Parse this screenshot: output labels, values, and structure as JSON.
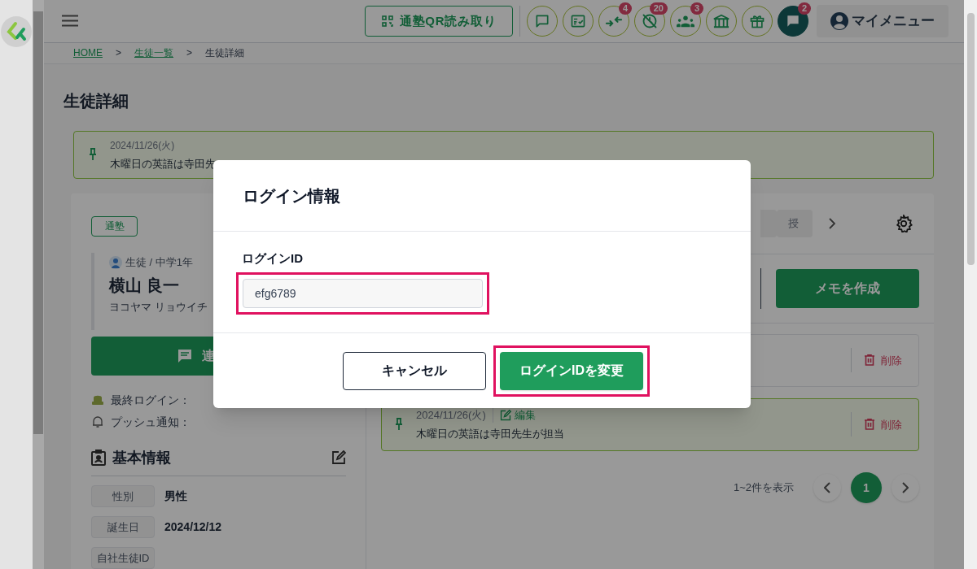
{
  "header": {
    "qr_button": "通塾QR読み取り",
    "icons": [
      {
        "kind": "chat",
        "filled": false
      },
      {
        "kind": "checklist",
        "filled": false
      },
      {
        "kind": "arrows",
        "filled": false,
        "badge": "4"
      },
      {
        "kind": "clock-off",
        "filled": false,
        "badge": "20"
      },
      {
        "kind": "group",
        "filled": false,
        "badge": "3"
      },
      {
        "kind": "bank",
        "filled": false
      },
      {
        "kind": "gift",
        "filled": false
      },
      {
        "kind": "chat",
        "filled": true,
        "badge": "2"
      }
    ],
    "my_menu": "マイメニュー"
  },
  "breadcrumb": {
    "items": [
      {
        "label": "HOME",
        "link": true
      },
      {
        "label": "生徒一覧",
        "link": true
      },
      {
        "label": "生徒詳細",
        "link": false
      }
    ],
    "separators": [
      ">",
      ">"
    ]
  },
  "page_title": "生徒詳細",
  "pinned_note": {
    "date": "2024/11/26(火)",
    "text": "木曜日の英語は寺田先"
  },
  "student": {
    "status_tag": "通塾",
    "role": "生徒 / 中学1年",
    "name": "横山 良一",
    "kana": "ヨコヤマ リョウイチ",
    "contact_button": "連",
    "last_login_label": "最終ログイン：",
    "push_label": "プッシュ通知："
  },
  "basic_info": {
    "title": "基本情報",
    "fields": [
      {
        "label": "性別",
        "value": "男性"
      },
      {
        "label": "誕生日",
        "value": "2024/12/12"
      },
      {
        "label": "自社生徒ID"
      }
    ]
  },
  "tabs": [
    {
      "label": "授",
      "selected": false
    }
  ],
  "create_memo_button": "メモを作成",
  "memos": [
    {
      "pinned": false,
      "delete": "削除"
    },
    {
      "pinned": true,
      "date": "2024/11/26(火)",
      "edit": "編集",
      "text": "木曜日の英語は寺田先生が担当",
      "delete": "削除"
    }
  ],
  "pagination": {
    "summary": "1~2件を表示",
    "pages": [
      {
        "label": "1",
        "selected": true
      }
    ]
  },
  "modal": {
    "title": "ログイン情報",
    "field_label": "ログインID",
    "value": "efg6789",
    "highlighted": true,
    "cancel": "キャンセル",
    "confirm": "ログインIDを変更"
  }
}
